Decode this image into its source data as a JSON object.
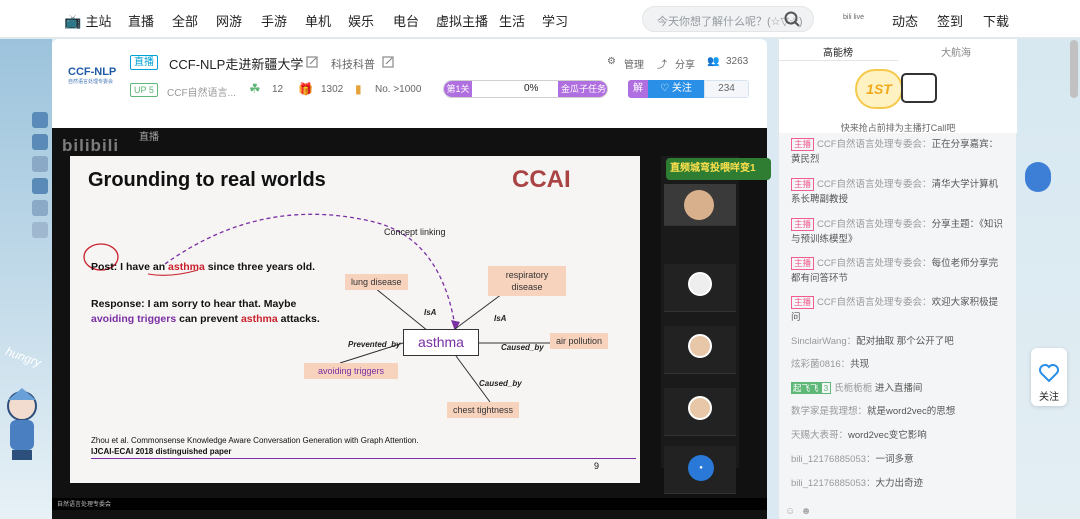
{
  "topnav": {
    "home": "主站",
    "items": [
      "直播",
      "全部",
      "网游",
      "手游",
      "单机",
      "娱乐",
      "电台",
      "虚拟主播",
      "生活",
      "学习"
    ],
    "search_placeholder": "今天你想了解什么呢？(☆▽☆)",
    "dynamic": "动态",
    "signin": "签到",
    "download": "下载"
  },
  "room": {
    "logo_text": "CCF-NLP",
    "logo_sub": "自然语言处理专委会",
    "live_tag": "直播",
    "title": "CCF-NLP走进新疆大学",
    "category": "科技科普",
    "up_level": "UP 5",
    "anchor": "CCF自然语言...",
    "gift_level": "12",
    "gifts": "1302",
    "rank": "No. >1000",
    "level_label": "第1关",
    "progress_pct": "0%",
    "task_label": "金瓜子任务",
    "follow_prefix": "解",
    "follow_label": "关注",
    "follow_count": "234",
    "manage": "管理",
    "share": "分享",
    "viewers": "3263"
  },
  "player": {
    "watermark": "bilibili",
    "watermark_sub": "直播",
    "banner": "直频城弯投喂咩变1",
    "bottom_label": "自然语言处理专委会"
  },
  "slide": {
    "title": "Grounding to real worlds",
    "logo": "CCAI",
    "post_prefix": "Post: I have an ",
    "post_highlight": "asthma",
    "post_suffix": " since three years old.",
    "response_1": "Response: I am sorry to hear that. Maybe",
    "response_purple": "avoiding triggers",
    "response_mid": " can prevent ",
    "response_red": "asthma",
    "response_end": " attacks.",
    "concept_linking": "Concept linking",
    "center": "asthma",
    "nodes": {
      "lung": "lung disease",
      "respiratory": "respiratory disease",
      "air": "air pollution",
      "avoid": "avoiding triggers",
      "chest": "chest tightness"
    },
    "edges": {
      "isa1": "IsA",
      "isa2": "IsA",
      "prevented": "Prevented_by",
      "caused1": "Caused_by",
      "caused2": "Caused_by"
    },
    "cite": "Zhou et al. Commonsense Knowledge Aware Conversation Generation with Graph Attention.",
    "cite2": "IJCAI-ECAI 2018 distinguished paper",
    "page": "9"
  },
  "sidebar": {
    "tab1": "高能榜",
    "tab2": "大航海",
    "rank_badge": "1ST",
    "rank_hint": "快来抢占前排为主播打Call吧",
    "messages": [
      {
        "host": true,
        "user": "CCF自然语言处理专委会",
        "text": "正在分享嘉宾：黄民烈"
      },
      {
        "host": true,
        "user": "CCF自然语言处理专委会",
        "text": "清华大学计算机系长聘副教授"
      },
      {
        "host": true,
        "user": "CCF自然语言处理专委会",
        "text": "分享主题：《知识与预训练模型》"
      },
      {
        "host": true,
        "user": "CCF自然语言处理专委会",
        "text": "每位老师分享完都有问答环节"
      },
      {
        "host": true,
        "user": "CCF自然语言处理专委会",
        "text": "欢迎大家积极提问"
      },
      {
        "host": false,
        "user": "SinclairWang",
        "text": "配对抽取 那个公开了吧"
      },
      {
        "host": false,
        "user": "炫彩菌0816",
        "text": "共现"
      },
      {
        "host": false,
        "fan": "起飞飞",
        "fan_level": "3",
        "user": "氏栀栀栀",
        "text": "进入直播间"
      },
      {
        "host": false,
        "user": "数学家是我理想",
        "text": "就是word2vec的思想"
      },
      {
        "host": false,
        "user": "天赐大表哥",
        "text": "word2vec变它影响"
      },
      {
        "host": false,
        "user": "bili_12176885053",
        "text": "一词多意"
      },
      {
        "host": false,
        "user": "bili_12176885053",
        "text": "大力出奇迹"
      }
    ],
    "host_badge": "主播"
  },
  "float": {
    "follow": "关注"
  },
  "decor": {
    "hungry": "hungry"
  }
}
